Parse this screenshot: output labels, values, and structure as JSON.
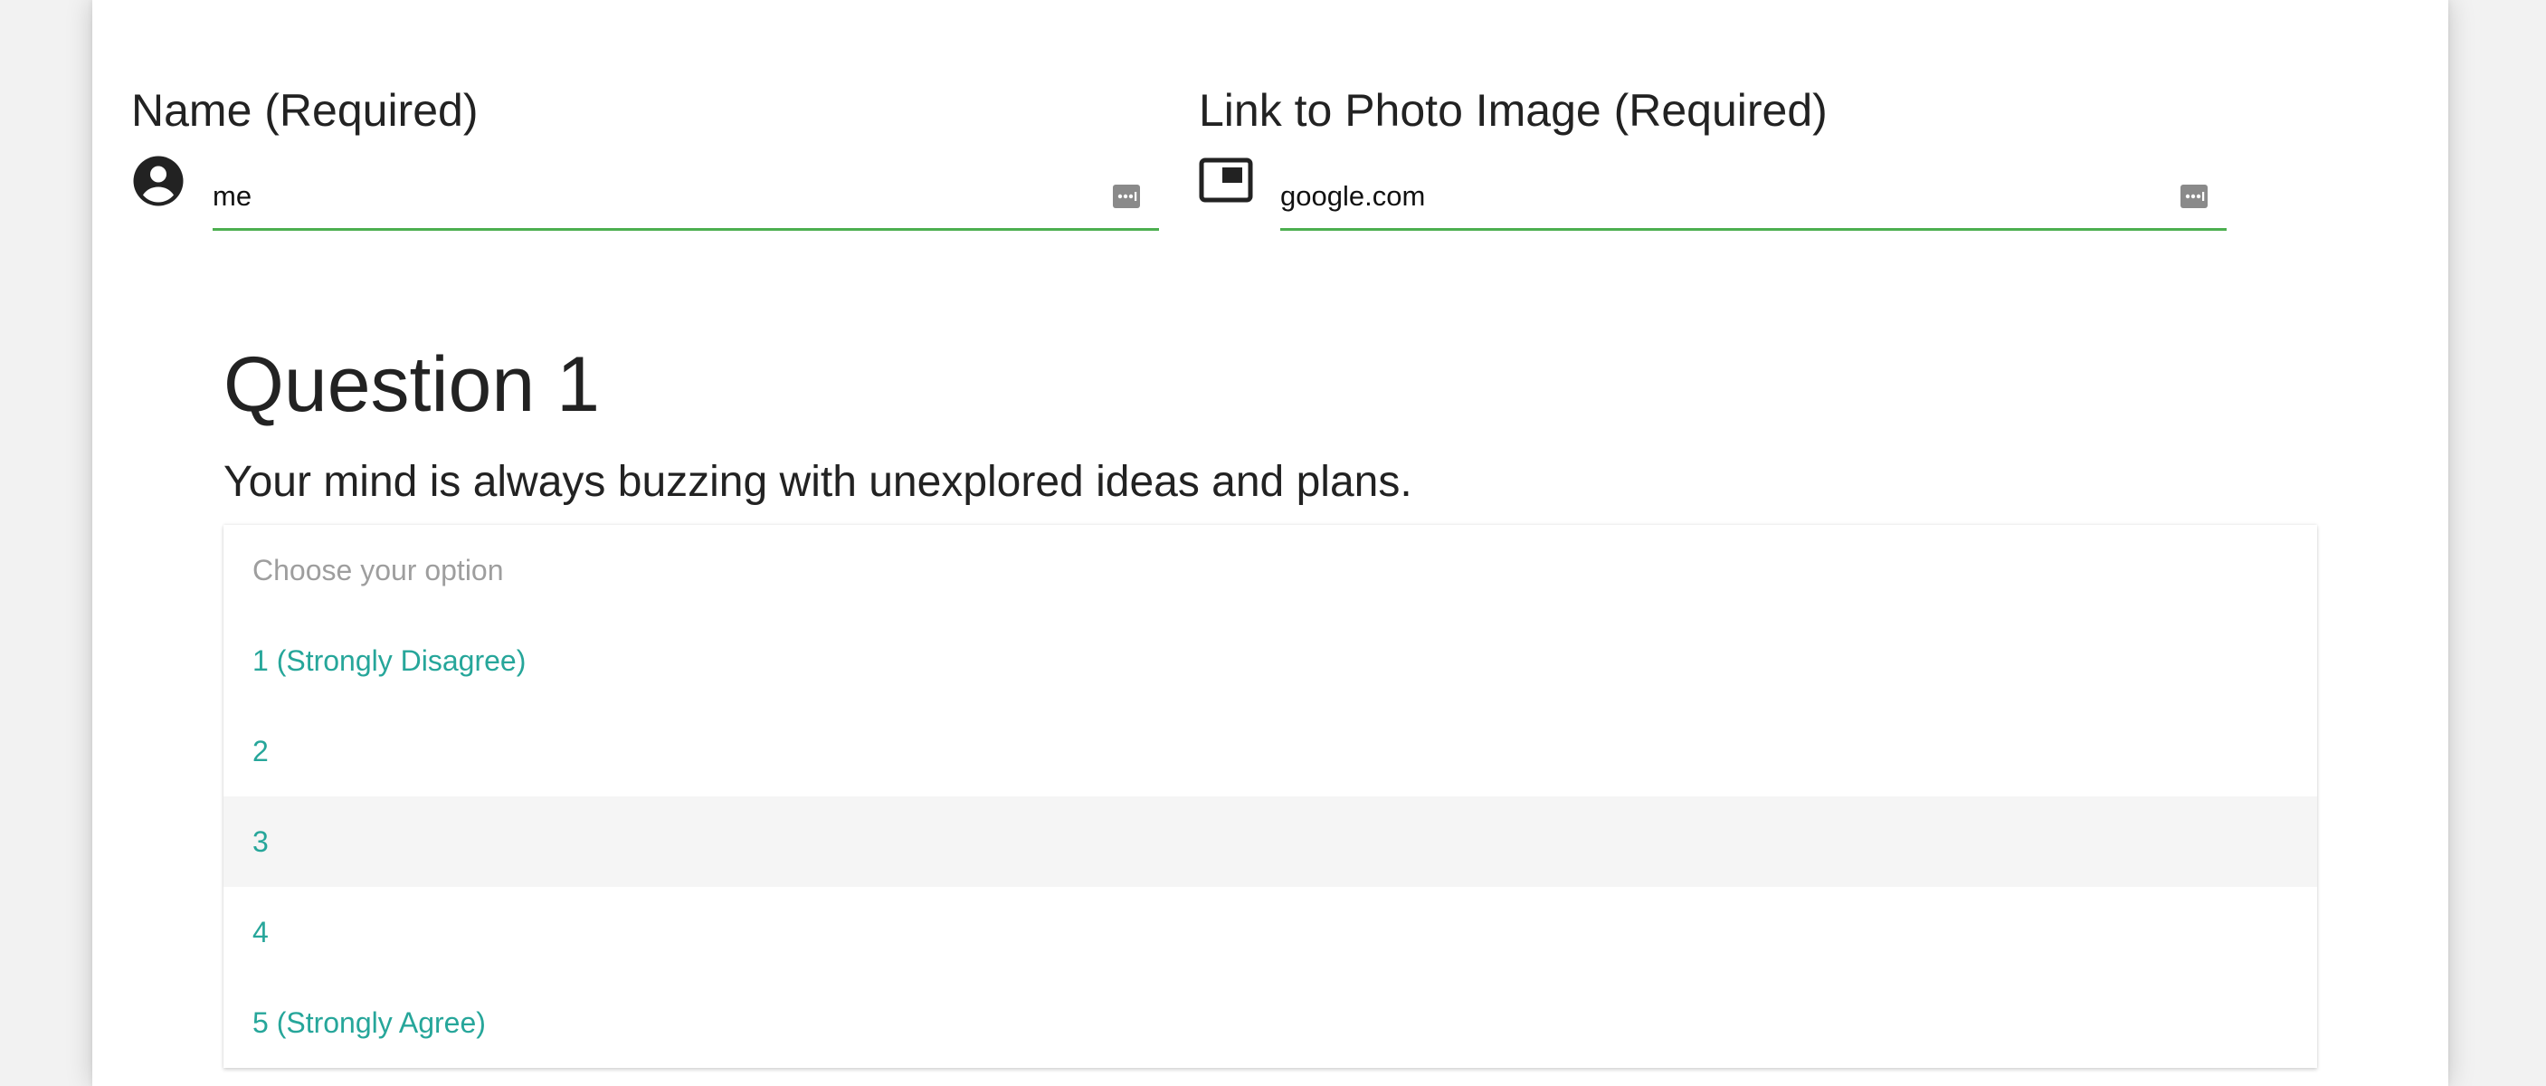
{
  "form": {
    "name_field": {
      "label": "Name (Required)",
      "value": "me",
      "icon": "account-circle-icon"
    },
    "photo_field": {
      "label": "Link to Photo Image (Required)",
      "value": "google.com",
      "icon": "picture-in-picture-icon"
    },
    "autofill_icon": "autofill-dots-icon",
    "accent_color": "#4caf50"
  },
  "question": {
    "title": "Question 1",
    "text": "Your mind is always buzzing with unexplored ideas and plans.",
    "dropdown": {
      "placeholder": "Choose your option",
      "options": [
        "1 (Strongly Disagree)",
        "2",
        "3",
        "4",
        "5 (Strongly Agree)"
      ],
      "hovered_option": "3",
      "option_color": "#26a69a"
    }
  }
}
